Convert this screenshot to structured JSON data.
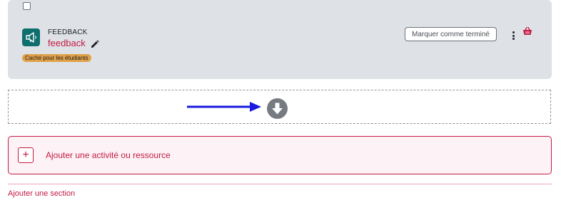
{
  "activity": {
    "modname": "FEEDBACK",
    "name": "feedback",
    "badge": "Caché pour les étudiants",
    "complete_button": "Marquer comme terminé",
    "icon": "megaphone-icon"
  },
  "actions": {
    "edit_icon": "pencil-icon",
    "menu_icon": "kebab-menu-icon",
    "extra_icon": "basket-icon"
  },
  "dropzone": {
    "icon": "arrow-down-circle-icon",
    "annotation": "blue-arrow"
  },
  "add_activity": {
    "plus": "+",
    "label": "Ajouter une activité ou ressource"
  },
  "add_section": {
    "label": "Ajouter une section"
  },
  "colors": {
    "brand": "#c31a45",
    "card_bg": "#dee2e6",
    "icon_bg": "#0f6e6e",
    "badge_bg": "#e0a048",
    "annotation": "#1a1ae0"
  }
}
